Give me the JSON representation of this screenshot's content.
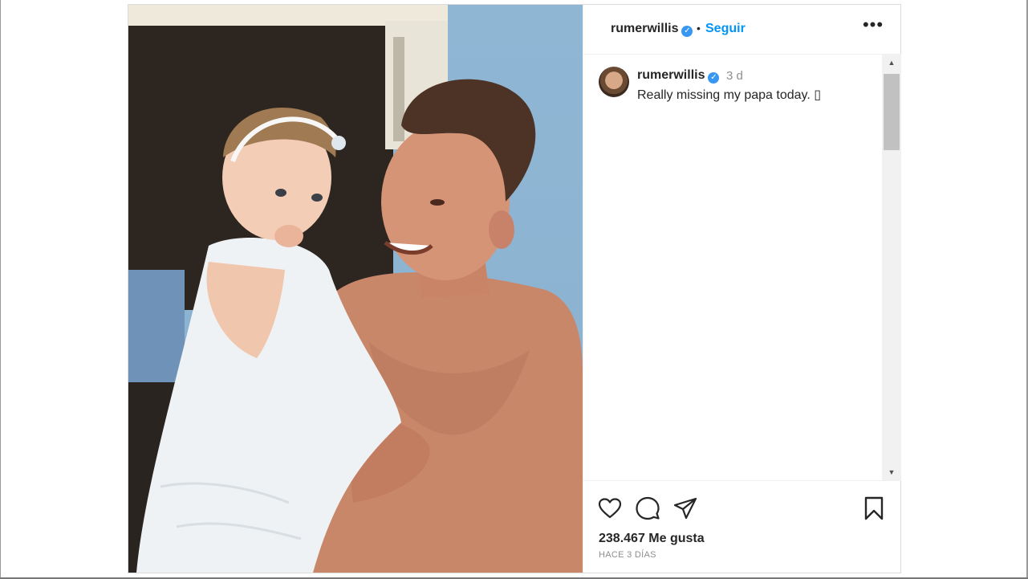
{
  "post": {
    "image": {
      "alt": ""
    },
    "header": {
      "username": "rumerwillis",
      "verified_glyph": "✓",
      "separator": "•",
      "follow_label": "Seguir",
      "more_glyph": "•••",
      "more_icon": "more-horizontal-icon"
    },
    "caption": {
      "username": "rumerwillis",
      "time": "3 d",
      "text": "Really missing my papa today. ▯"
    },
    "scrollbar": {
      "up_glyph": "▲",
      "down_glyph": "▼"
    },
    "actions": {
      "like_icon": "heart-icon",
      "comment_icon": "comment-bubble-icon",
      "share_icon": "paper-plane-icon",
      "save_icon": "bookmark-icon"
    },
    "likes": "238.467 Me gusta",
    "timestamp": "HACE 3 DÍAS"
  },
  "colors": {
    "accent": "#0095f6",
    "verified": "#3897f0",
    "text": "#262626",
    "muted": "#8e8e8e"
  }
}
